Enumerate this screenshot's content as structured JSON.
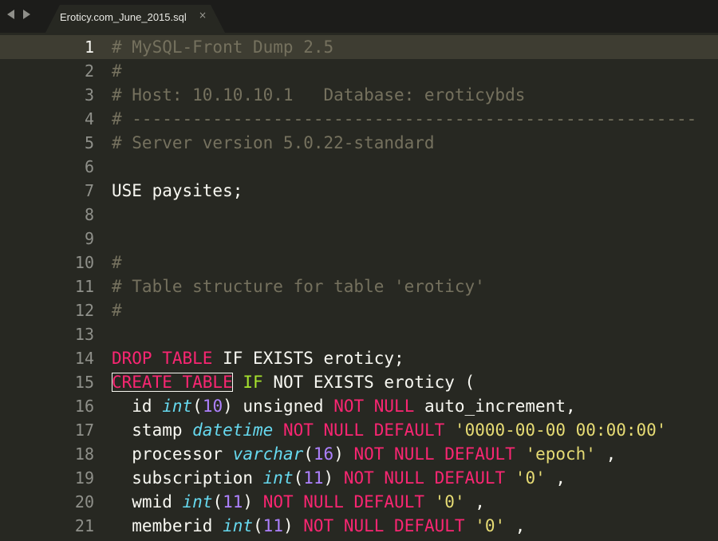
{
  "tabbar": {
    "nav_back_icon": "chevron-left-icon",
    "nav_forward_icon": "chevron-right-icon",
    "tab_title": "Eroticy.com_June_2015.sql",
    "tab_close": "×"
  },
  "editor": {
    "current_line": 1,
    "colors": {
      "background": "#272822",
      "comment": "#75715e",
      "keyword": "#f92672",
      "type": "#66d9ef",
      "number": "#ae81ff",
      "string": "#e6db74",
      "plain": "#f8f8f2",
      "green": "#a6e22e"
    },
    "lines": [
      {
        "n": "1",
        "tokens": [
          {
            "t": "comment",
            "v": "# MySQL-Front Dump 2.5"
          }
        ]
      },
      {
        "n": "2",
        "tokens": [
          {
            "t": "comment",
            "v": "#"
          }
        ]
      },
      {
        "n": "3",
        "tokens": [
          {
            "t": "comment",
            "v": "# Host: 10.10.10.1   Database: eroticybds"
          }
        ]
      },
      {
        "n": "4",
        "tokens": [
          {
            "t": "comment",
            "v": "# --------------------------------------------------------"
          }
        ]
      },
      {
        "n": "5",
        "tokens": [
          {
            "t": "comment",
            "v": "# Server version 5.0.22-standard"
          }
        ]
      },
      {
        "n": "6",
        "tokens": []
      },
      {
        "n": "7",
        "tokens": [
          {
            "t": "plain",
            "v": "USE paysites;"
          }
        ]
      },
      {
        "n": "8",
        "tokens": []
      },
      {
        "n": "9",
        "tokens": []
      },
      {
        "n": "10",
        "tokens": [
          {
            "t": "comment",
            "v": "#"
          }
        ]
      },
      {
        "n": "11",
        "tokens": [
          {
            "t": "comment",
            "v": "# Table structure for table 'eroticy'"
          }
        ]
      },
      {
        "n": "12",
        "tokens": [
          {
            "t": "comment",
            "v": "#"
          }
        ]
      },
      {
        "n": "13",
        "tokens": []
      },
      {
        "n": "14",
        "tokens": [
          {
            "t": "keyword",
            "v": "DROP TABLE"
          },
          {
            "t": "plain",
            "v": " IF EXISTS eroticy;"
          }
        ]
      },
      {
        "n": "15",
        "tokens": [
          {
            "t": "boxed",
            "v": "CREATE TABLE"
          },
          {
            "t": "plain",
            "v": " "
          },
          {
            "t": "green",
            "v": "IF"
          },
          {
            "t": "plain",
            "v": " NOT EXISTS eroticy ("
          }
        ]
      },
      {
        "n": "16",
        "tokens": [
          {
            "t": "plain",
            "v": "  id "
          },
          {
            "t": "type",
            "v": "int"
          },
          {
            "t": "plain",
            "v": "("
          },
          {
            "t": "number",
            "v": "10"
          },
          {
            "t": "plain",
            "v": ") unsigned "
          },
          {
            "t": "keyword",
            "v": "NOT NULL"
          },
          {
            "t": "plain",
            "v": " auto_increment,"
          }
        ]
      },
      {
        "n": "17",
        "tokens": [
          {
            "t": "plain",
            "v": "  stamp "
          },
          {
            "t": "type",
            "v": "datetime"
          },
          {
            "t": "plain",
            "v": " "
          },
          {
            "t": "keyword",
            "v": "NOT NULL DEFAULT"
          },
          {
            "t": "plain",
            "v": " "
          },
          {
            "t": "string",
            "v": "'0000-00-00 00:00:00'"
          }
        ]
      },
      {
        "n": "18",
        "tokens": [
          {
            "t": "plain",
            "v": "  processor "
          },
          {
            "t": "type",
            "v": "varchar"
          },
          {
            "t": "plain",
            "v": "("
          },
          {
            "t": "number",
            "v": "16"
          },
          {
            "t": "plain",
            "v": ") "
          },
          {
            "t": "keyword",
            "v": "NOT NULL DEFAULT"
          },
          {
            "t": "plain",
            "v": " "
          },
          {
            "t": "string",
            "v": "'epoch'"
          },
          {
            "t": "plain",
            "v": " ,"
          }
        ]
      },
      {
        "n": "19",
        "tokens": [
          {
            "t": "plain",
            "v": "  subscription "
          },
          {
            "t": "type",
            "v": "int"
          },
          {
            "t": "plain",
            "v": "("
          },
          {
            "t": "number",
            "v": "11"
          },
          {
            "t": "plain",
            "v": ") "
          },
          {
            "t": "keyword",
            "v": "NOT NULL DEFAULT"
          },
          {
            "t": "plain",
            "v": " "
          },
          {
            "t": "string",
            "v": "'0'"
          },
          {
            "t": "plain",
            "v": " ,"
          }
        ]
      },
      {
        "n": "20",
        "tokens": [
          {
            "t": "plain",
            "v": "  wmid "
          },
          {
            "t": "type",
            "v": "int"
          },
          {
            "t": "plain",
            "v": "("
          },
          {
            "t": "number",
            "v": "11"
          },
          {
            "t": "plain",
            "v": ") "
          },
          {
            "t": "keyword",
            "v": "NOT NULL DEFAULT"
          },
          {
            "t": "plain",
            "v": " "
          },
          {
            "t": "string",
            "v": "'0'"
          },
          {
            "t": "plain",
            "v": " ,"
          }
        ]
      },
      {
        "n": "21",
        "tokens": [
          {
            "t": "plain",
            "v": "  memberid "
          },
          {
            "t": "type",
            "v": "int"
          },
          {
            "t": "plain",
            "v": "("
          },
          {
            "t": "number",
            "v": "11"
          },
          {
            "t": "plain",
            "v": ") "
          },
          {
            "t": "keyword",
            "v": "NOT NULL DEFAULT"
          },
          {
            "t": "plain",
            "v": " "
          },
          {
            "t": "string",
            "v": "'0'"
          },
          {
            "t": "plain",
            "v": " ,"
          }
        ]
      }
    ]
  }
}
